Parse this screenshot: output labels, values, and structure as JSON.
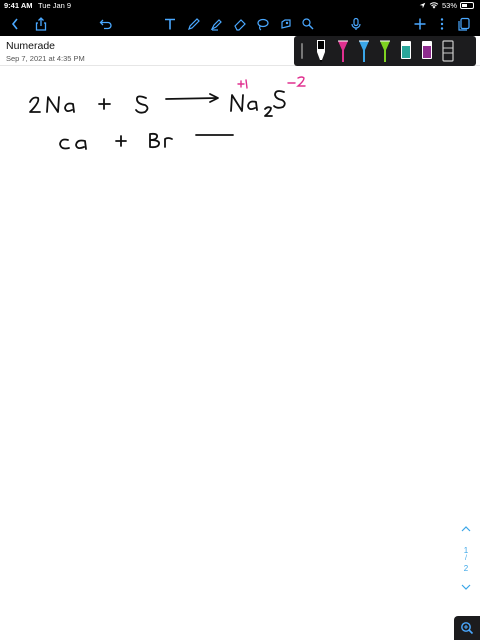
{
  "status_bar": {
    "time": "9:41 AM",
    "date": "Tue Jan 9",
    "battery": "53%",
    "icons": [
      "wifi-icon",
      "location-icon",
      "battery-icon"
    ]
  },
  "toolbar": {
    "left_icons": [
      "back-chevron-icon",
      "share-icon",
      "undo-icon"
    ],
    "tool_icons": [
      "text-tool-icon",
      "pen-tool-icon",
      "highlighter-icon",
      "eraser-icon",
      "lasso-icon",
      "image-icon",
      "shape-icon"
    ],
    "right_icons": [
      "microphone-icon",
      "add-icon",
      "more-icon",
      "pages-icon"
    ]
  },
  "document": {
    "title": "Numerade",
    "date": "Sep 7, 2021 at 4:35 PM"
  },
  "pen_tray": {
    "colors": [
      "#000000",
      "#e0308f",
      "#3aa6e8",
      "#7ed321",
      "#2aa69a",
      "#8e2c8e"
    ]
  },
  "handwriting": {
    "line1": [
      "2",
      "Na",
      "+",
      "S",
      "Na",
      "2",
      "S"
    ],
    "charges": [
      "+1",
      "−2"
    ],
    "line2": [
      "Ca",
      "+",
      "Br"
    ]
  },
  "page_nav": {
    "current": "1",
    "separator": "/",
    "total": "2"
  },
  "accent_color": "#3aa6e8",
  "charge_color": "#e0308f"
}
